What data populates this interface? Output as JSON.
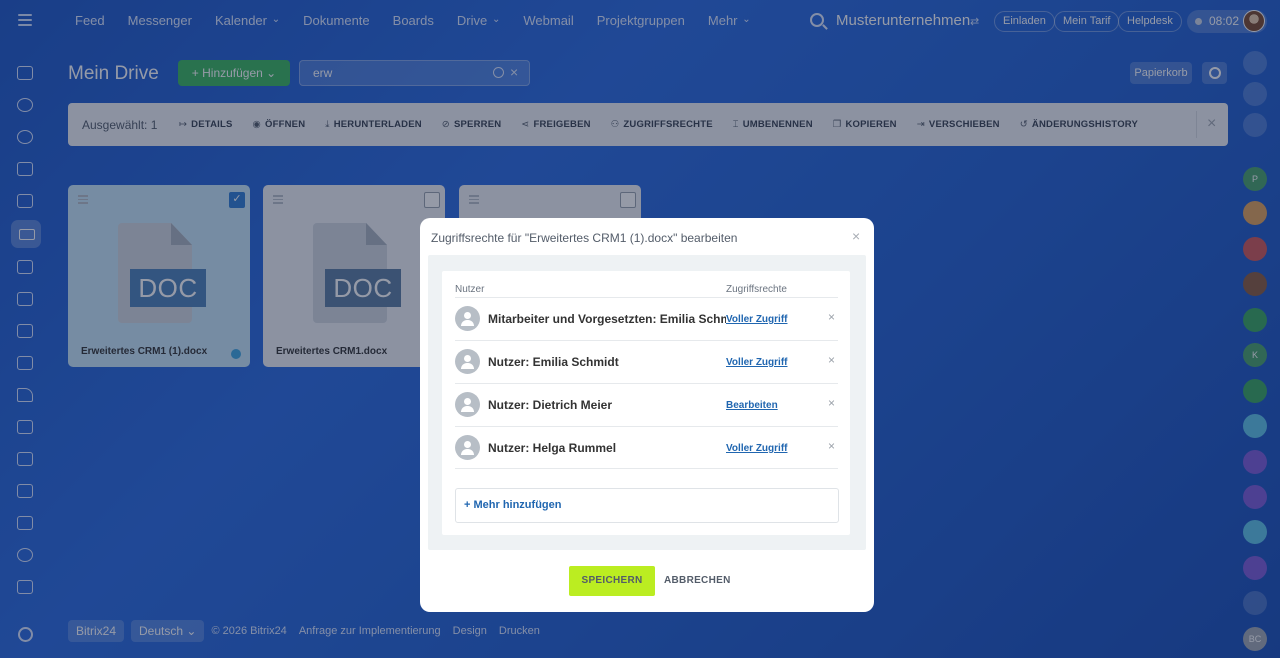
{
  "topbar": {
    "nav": [
      "Feed",
      "Messenger",
      "Kalender",
      "Dokumente",
      "Boards",
      "Drive",
      "Webmail",
      "Projektgruppen",
      "Mehr"
    ],
    "company": "Musterunternehmen",
    "company_switch": "⇄",
    "invite": "Einladen",
    "tariff": "Mein Tarif",
    "helpdesk": "Helpdesk",
    "time": "08:02"
  },
  "header": {
    "title": "Mein Drive",
    "add_label": "+ Hinzufügen ⌄",
    "search_value": "erw",
    "trash_label": "Papierkorb"
  },
  "actionbar": {
    "selected": "Ausgewählt: 1",
    "actions": [
      {
        "icon": "↦",
        "label": "DETAILS"
      },
      {
        "icon": "◉",
        "label": "ÖFFNEN"
      },
      {
        "icon": "⤓",
        "label": "HERUNTERLADEN"
      },
      {
        "icon": "⊘",
        "label": "SPERREN"
      },
      {
        "icon": "⋖",
        "label": "FREIGEBEN"
      },
      {
        "icon": "⚇",
        "label": "ZUGRIFFSRECHTE"
      },
      {
        "icon": "⌶",
        "label": "UMBENENNEN"
      },
      {
        "icon": "❐",
        "label": "KOPIEREN"
      },
      {
        "icon": "⇥",
        "label": "VERSCHIEBEN"
      },
      {
        "icon": "↺",
        "label": "ÄNDERUNGSHISTORY"
      }
    ],
    "close": "×"
  },
  "files": [
    {
      "name": "Erweitertes CRM1 (1).docx",
      "type": "DOC",
      "selected": true
    },
    {
      "name": "Erweitertes CRM1.docx",
      "type": "DOC",
      "selected": false
    },
    {
      "name": "",
      "type": "",
      "selected": false
    }
  ],
  "footer": {
    "brand": "Bitrix24",
    "language": "Deutsch ⌄",
    "copyright": "© 2026 Bitrix24",
    "links": [
      "Anfrage zur Implementierung",
      "Design",
      "Drucken"
    ]
  },
  "right_sidebar": {
    "initials": [
      "P",
      "K",
      "BC"
    ]
  },
  "modal": {
    "title": "Zugriffsrechte für \"Erweitertes CRM1 (1).docx\" bearbeiten",
    "close": "×",
    "col_user": "Nutzer",
    "col_rights": "Zugriffsrechte",
    "rows": [
      {
        "name": "Mitarbeiter und Vorgesetzten: Emilia Schmidt",
        "right": "Voller Zugriff"
      },
      {
        "name": "Nutzer: Emilia Schmidt",
        "right": "Voller Zugriff"
      },
      {
        "name": "Nutzer: Dietrich Meier",
        "right": "Bearbeiten"
      },
      {
        "name": "Nutzer: Helga Rummel",
        "right": "Voller Zugriff"
      }
    ],
    "delete": "×",
    "add_more": "+ Mehr hinzufügen",
    "save": "SPEICHERN",
    "cancel": "ABBRECHEN"
  },
  "colors": {
    "accent_green": "#bbed21",
    "add_green": "#3bb65d",
    "link_blue": "#2066b0",
    "background_blue": "#2462d2"
  }
}
